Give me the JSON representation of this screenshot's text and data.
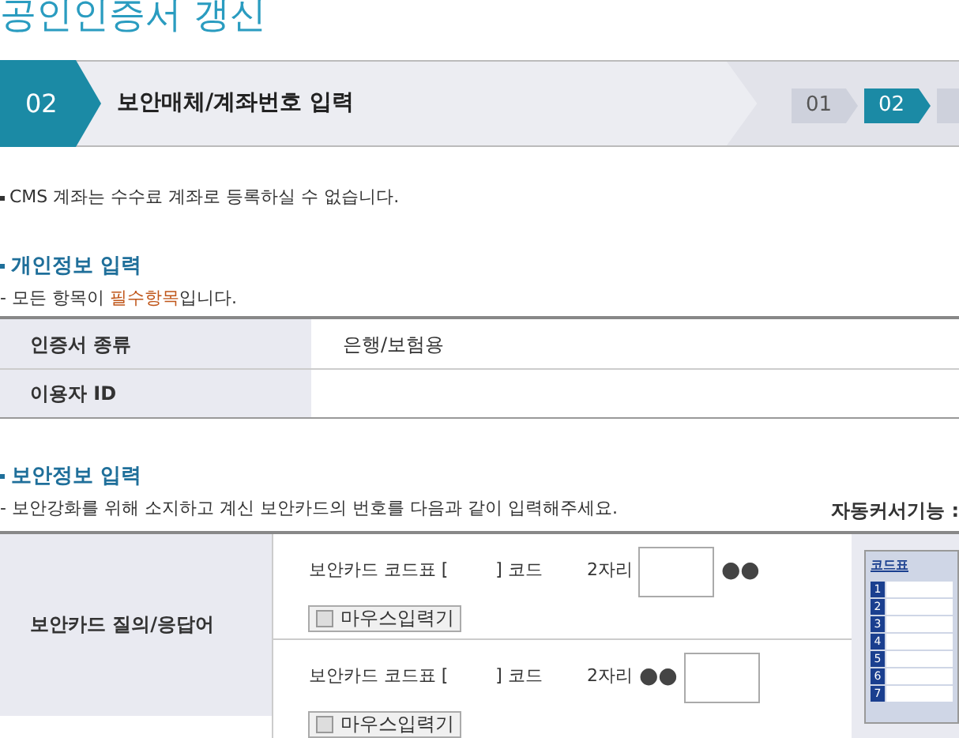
{
  "page_title": "공인인증서 갱신",
  "step_bar": {
    "number": "02",
    "title": "보안매체/계좌번호 입력",
    "steps": [
      {
        "label": "01",
        "selected": false
      },
      {
        "label": "02",
        "selected": true
      },
      {
        "selected": false
      }
    ]
  },
  "notice": "CMS 계좌는 수수료 계좌로 등록하실 수 없습니다.",
  "personal": {
    "heading": "개인정보 입력",
    "note": "- 모든 항목이 **필수항목**입니다.",
    "rows": [
      {
        "label": "인증서 종류",
        "value": "은행/보험용"
      },
      {
        "label": "이용자 ID"
      }
    ]
  },
  "security": {
    "heading": "보안정보 입력",
    "note": "- 보안강화를 위해 소지하고 계신 보안카드의 번호를 다음과 같이 입력해주세요.",
    "auto_cursor": "자동커서기능 :",
    "label": "보안카드 질의/응답어",
    "rows": [
      {
        "prefix": "보안카드 코드표 [",
        "mid": "] 코드",
        "digits": "2자리",
        "dots": "●●",
        "dots_first": false,
        "mouse_input": {
          "label": "마우스입력기",
          "checked": false
        }
      },
      {
        "prefix": "보안카드 코드표 [",
        "mid": "] 코드",
        "digits": "2자리",
        "dots": "●●",
        "dots_first": true,
        "mouse_input": {
          "label": "마우스입력기",
          "checked": false
        }
      }
    ],
    "code_card": {
      "title": "코드표",
      "numbers": [
        "1",
        "2",
        "3",
        "4",
        "5",
        "6",
        "7"
      ]
    }
  }
}
